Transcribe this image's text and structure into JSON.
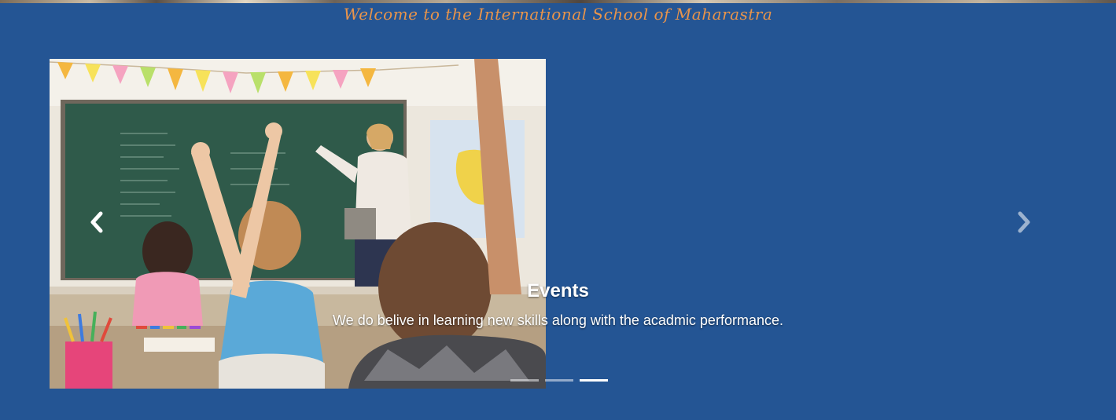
{
  "header": {
    "welcome_text": "Welcome to the International School of Maharastra"
  },
  "carousel": {
    "slide_image": {
      "alt": "Children raising hands in a classroom with a teacher at the chalkboard"
    },
    "caption": {
      "title": "Events",
      "text": "We do belive in learning new skills along with the acadmic performance."
    },
    "indicators": [
      {
        "label": "Slide 1",
        "active": false
      },
      {
        "label": "Slide 2",
        "active": false
      },
      {
        "label": "Slide 3",
        "active": true
      }
    ],
    "prev_icon": "chevron-left-icon",
    "next_icon": "chevron-right-icon"
  },
  "colors": {
    "background": "#245594",
    "welcome_text": "#e8944b",
    "caption_text": "#ffffff"
  }
}
